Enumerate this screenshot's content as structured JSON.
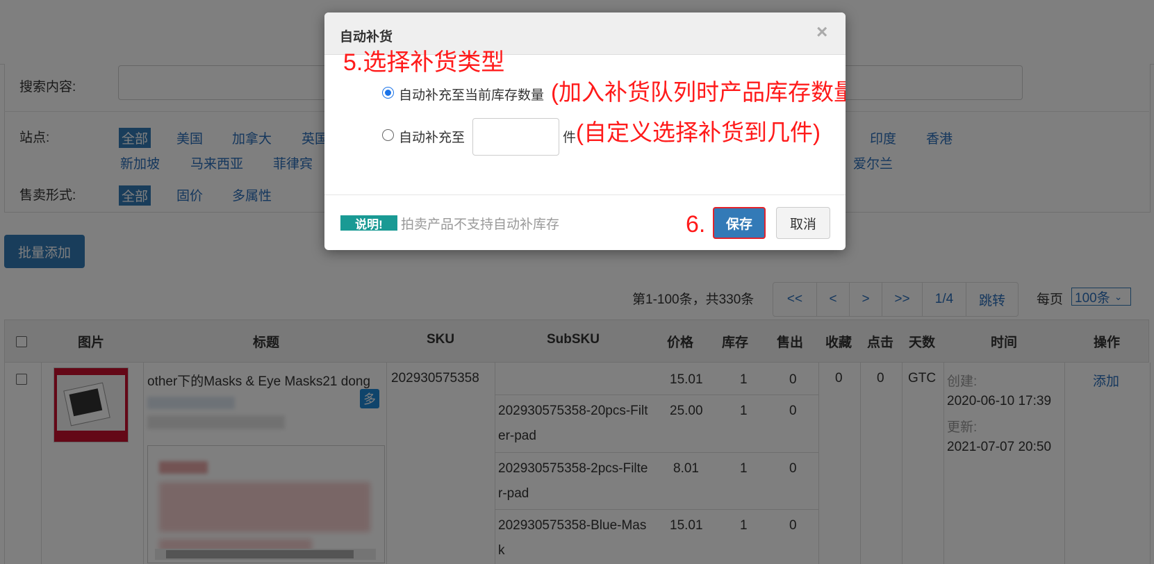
{
  "filters": {
    "search_label": "搜索内容:",
    "site_label": "站点:",
    "site_options_row1": [
      "全部",
      "美国",
      "加拿大",
      "英国"
    ],
    "site_options_right": [
      "印度",
      "香港"
    ],
    "site_options_row2": [
      "新加坡",
      "马来西亚",
      "菲律宾"
    ],
    "site_options_row2_right": [
      "爱尔兰"
    ],
    "sale_label": "售卖形式:",
    "sale_options": [
      "全部",
      "固价",
      "多属性"
    ]
  },
  "toolbar": {
    "batch_add": "批量添加"
  },
  "pagination": {
    "info": "第1-100条，共330条",
    "buttons": [
      "<<",
      "<",
      ">",
      ">>",
      "1/4",
      "跳转"
    ],
    "per_page_label": "每页",
    "per_page_value": "100条"
  },
  "table": {
    "headers": [
      "图片",
      "标题",
      "SKU",
      "SubSKU",
      "价格",
      "库存",
      "售出",
      "收藏",
      "点击",
      "天数",
      "时间",
      "操作"
    ],
    "row": {
      "title": "other下的Masks & Eye Masks21 dong",
      "badge": "多",
      "sku": "202930575358",
      "favorites": "0",
      "clicks": "0",
      "days": "GTC",
      "created_label": "创建:",
      "created": "2020-06-10 17:39",
      "updated_label": "更新:",
      "updated": "2021-07-07 20:50",
      "action": "添加",
      "subs": [
        {
          "subsku_l1": "",
          "subsku_l2": "",
          "price": "15.01",
          "stock": "1",
          "sold": "0"
        },
        {
          "subsku_l1": "202930575358-20pcs-Filt",
          "subsku_l2": "er-pad",
          "price": "25.00",
          "stock": "1",
          "sold": "0"
        },
        {
          "subsku_l1": "202930575358-2pcs-Filte",
          "subsku_l2": "r-pad",
          "price": "8.01",
          "stock": "1",
          "sold": "0"
        },
        {
          "subsku_l1": "202930575358-Blue-Mas",
          "subsku_l2": "k",
          "price": "15.01",
          "stock": "1",
          "sold": "0"
        }
      ]
    }
  },
  "modal": {
    "title": "自动补货",
    "close": "×",
    "option1": "自动补充至当前库存数量",
    "option2": "自动补充至",
    "unit": "件",
    "input_value": "",
    "note_badge": "说明!",
    "note_text": "拍卖产品不支持自动补库存",
    "save": "保存",
    "cancel": "取消"
  },
  "annotations": {
    "step5": "5.选择补货类型",
    "opt1_note": "(加入补货队列时产品库存数量)",
    "opt2_note": "(自定义选择补货到几件)",
    "step6": "6."
  }
}
